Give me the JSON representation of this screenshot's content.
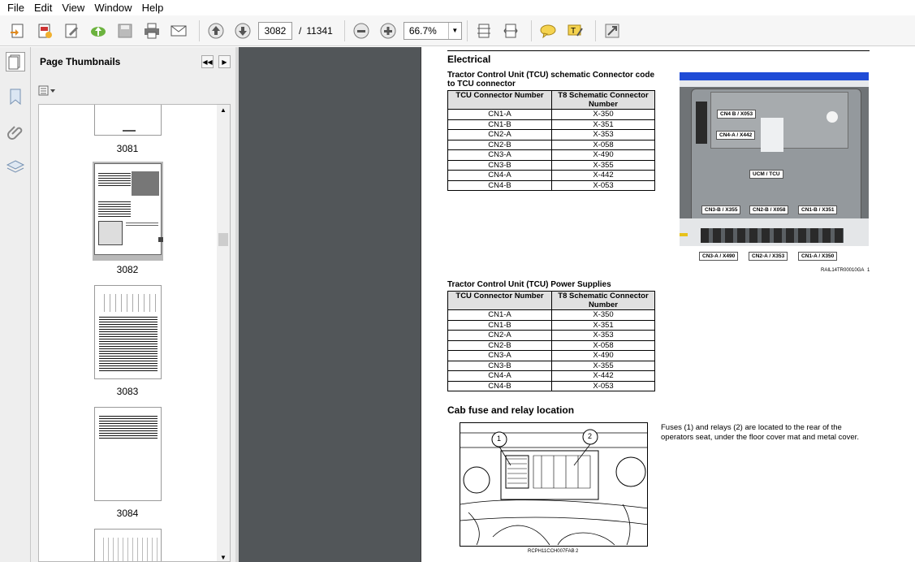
{
  "menu": [
    "File",
    "Edit",
    "View",
    "Window",
    "Help"
  ],
  "toolbar": {
    "page_current": "3082",
    "page_sep": "/",
    "page_total": "11341",
    "zoom": "66.7%"
  },
  "panel": {
    "title": "Page Thumbnails"
  },
  "thumbnails": [
    {
      "label": "3081"
    },
    {
      "label": "3082",
      "selected": true
    },
    {
      "label": "3083"
    },
    {
      "label": "3084"
    }
  ],
  "doc": {
    "section": "Electrical",
    "table1_caption": "Tractor Control Unit (TCU) schematic Connector code to TCU connector",
    "table2_caption": "Tractor Control Unit (TCU) Power Supplies",
    "col1": "TCU Connector Number",
    "col2": "T8 Schematic Connector Number",
    "rows": [
      [
        "CN1-A",
        "X-350"
      ],
      [
        "CN1-B",
        "X-351"
      ],
      [
        "CN2-A",
        "X-353"
      ],
      [
        "CN2-B",
        "X-058"
      ],
      [
        "CN3-A",
        "X-490"
      ],
      [
        "CN3-B",
        "X-355"
      ],
      [
        "CN4-A",
        "X-442"
      ],
      [
        "CN4-B",
        "X-053"
      ]
    ],
    "photo_labels": {
      "cn4b": "CN4 B / X053",
      "cn4a": "CN4-A / X442",
      "ucm": "UCM / TCU",
      "cn3b": "CN3-B / X355",
      "cn2b": "CN2-B / X058",
      "cn1b": "CN1-B / X351",
      "cn3a": "CN3-A / X490",
      "cn2a": "CN2-A / X353",
      "cn1a": "CN1-A / X350"
    },
    "photo_ref": "RAIL14TR00010GA",
    "photo_num": "1",
    "section2": "Cab fuse and relay location",
    "para": "Fuses (1) and relays (2) are located to the rear of the operators seat, under the floor cover mat and metal cover.",
    "callout1": "1",
    "callout2": "2",
    "sketch_ref": "RCPH11CCH007FAB",
    "sketch_num": "2"
  },
  "colors": {
    "toolbar_bg": "#f6f6f6",
    "panel_bg": "#eeeeee",
    "gray_bg": "#525659"
  }
}
